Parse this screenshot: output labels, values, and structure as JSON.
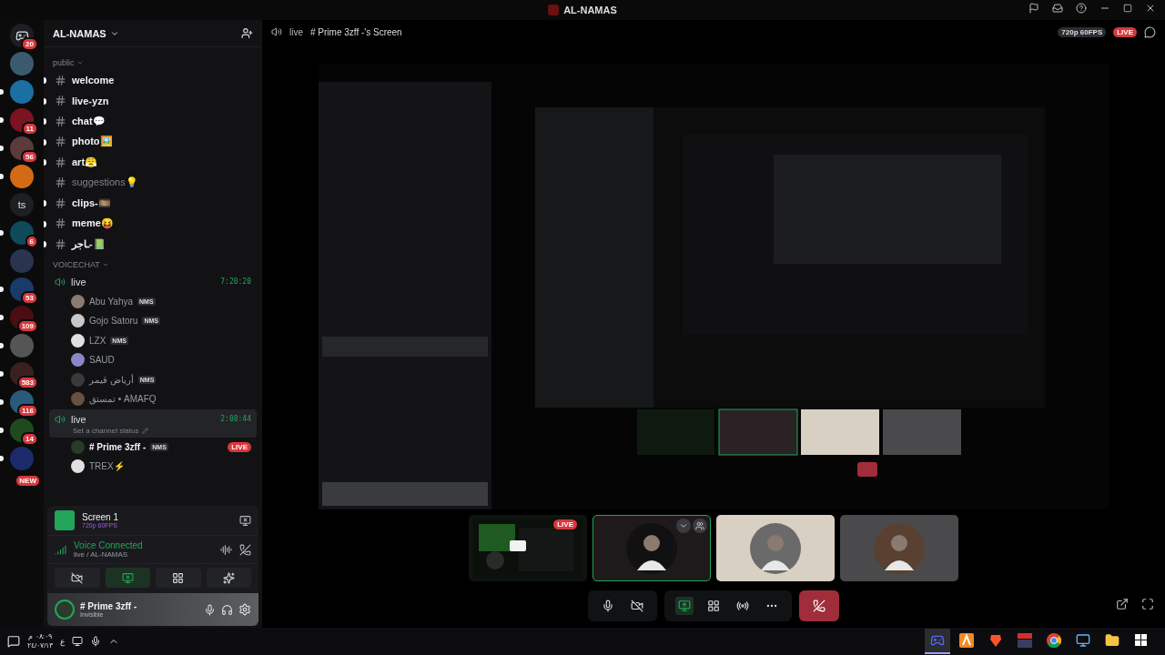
{
  "window": {
    "title": "AL-NAMAS"
  },
  "servers": [
    {
      "kind": "home",
      "badge": "20",
      "unread": false
    },
    {
      "kind": "avatar",
      "color": "#3b5a6e",
      "unread": false
    },
    {
      "kind": "avatar",
      "color": "#1c6fa3",
      "unread": true
    },
    {
      "kind": "avatar",
      "color": "#7a1420",
      "badge": "11",
      "unread": true
    },
    {
      "kind": "avatar",
      "color": "#5a3a3a",
      "badge": "56",
      "unread": true
    },
    {
      "kind": "avatar",
      "color": "#d46a14",
      "unread": true
    },
    {
      "kind": "text",
      "label": "ts",
      "unread": false
    },
    {
      "kind": "avatar",
      "color": "#0f4a5a",
      "badge": "6",
      "unread": true
    },
    {
      "kind": "avatar",
      "color": "#2a3350",
      "unread": false
    },
    {
      "kind": "avatar",
      "color": "#1a3a6a",
      "badge": "53",
      "unread": true
    },
    {
      "kind": "avatar",
      "color": "#4a0e12",
      "badge": "109",
      "unread": true
    },
    {
      "kind": "avatar",
      "color": "#555555",
      "unread": true
    },
    {
      "kind": "avatar",
      "color": "#3a2020",
      "badge": "583",
      "unread": true
    },
    {
      "kind": "avatar",
      "color": "#2a5a7a",
      "badge": "116",
      "unread": true
    },
    {
      "kind": "avatar",
      "color": "#1e4a1e",
      "badge": "14",
      "unread": true
    },
    {
      "kind": "avatar",
      "color": "#1a2a6a",
      "badge": "NEW",
      "unread": true
    }
  ],
  "server": {
    "name": "AL-NAMAS"
  },
  "categories": [
    {
      "name": "public",
      "channels": [
        {
          "kind": "text",
          "name": "welcome",
          "unread": true
        },
        {
          "kind": "text",
          "name": "live-yzn",
          "unread": true
        },
        {
          "kind": "text",
          "name": "chat💬",
          "unread": true
        },
        {
          "kind": "text",
          "name": "photo🖼️",
          "unread": true
        },
        {
          "kind": "text",
          "name": "art😤",
          "unread": true
        },
        {
          "kind": "text",
          "name": "suggestions💡",
          "unread": false
        },
        {
          "kind": "text",
          "name": "clips-🎞️",
          "unread": true
        },
        {
          "kind": "text",
          "name": "meme😝",
          "unread": true
        },
        {
          "kind": "text",
          "name": "ـاجر-📗",
          "unread": true
        }
      ]
    },
    {
      "name": "VOICECHAT",
      "channels": [
        {
          "kind": "voice",
          "name": "live",
          "timer": "7:20:20",
          "selected": false,
          "members": [
            {
              "name": "Abu Yahya",
              "tag": "NMS",
              "color": "#8a7a70",
              "live": false
            },
            {
              "name": "Gojo Satoru",
              "tag": "NMS",
              "color": "#c8c8c8",
              "live": false
            },
            {
              "name": "LZX",
              "tag": "NMS",
              "color": "#e0e0e0",
              "live": false
            },
            {
              "name": "SAUD",
              "color": "#8a86c8",
              "live": false
            },
            {
              "name": "أرياض قيمر",
              "tag": "NMS",
              "color": "#3a3a3a",
              "live": false
            },
            {
              "name": "تمستق • AMAFQ",
              "color": "#6a5040",
              "live": false
            }
          ]
        },
        {
          "kind": "voice",
          "name": "live",
          "timer": "2:08:44",
          "selected": true,
          "status": "Set a channel status",
          "members": [
            {
              "name": "# Prime 3zff -",
              "tag": "NMS",
              "color": "#2a3a2a",
              "live": true,
              "badge": "LIVE"
            },
            {
              "name": "TREX⚡",
              "color": "#e0e0e0",
              "live": false
            }
          ]
        }
      ]
    }
  ],
  "stream_panel": {
    "title": "Screen 1",
    "quality": "720p 60FPS"
  },
  "voice": {
    "status": "Voice Connected",
    "location": "live / AL-NAMAS"
  },
  "voice_buttons": [
    {
      "kind": "camera",
      "active": false
    },
    {
      "kind": "screen",
      "active": true
    },
    {
      "kind": "activities",
      "active": false
    },
    {
      "kind": "soundboard",
      "active": false
    }
  ],
  "user": {
    "name": "# Prime 3zff -",
    "status": "Invisible"
  },
  "stream_header": {
    "channel": "live",
    "title": "# Prime 3zff -'s Screen",
    "quality": "720p 60FPS",
    "badge": "LIVE"
  },
  "tiles": [
    {
      "kind": "screen",
      "badge": "LIVE",
      "color": "#101410",
      "selected": false
    },
    {
      "kind": "avatar",
      "color": "#1e1a1c",
      "selected": true
    },
    {
      "kind": "avatar",
      "color": "#d9d0c4",
      "selected": false
    },
    {
      "kind": "avatar",
      "color": "#4a4a4c",
      "selected": false
    }
  ],
  "taskbar": {
    "time": "٠٨:٠٩ م",
    "date": "٢٤/٠٧/١٣",
    "language": "ع",
    "apps": [
      {
        "kind": "discord",
        "active": true
      },
      {
        "kind": "orange",
        "active": false
      },
      {
        "kind": "brave",
        "active": false
      },
      {
        "kind": "red",
        "active": false
      },
      {
        "kind": "chrome",
        "active": false
      },
      {
        "kind": "computer",
        "active": false
      },
      {
        "kind": "folder",
        "active": false
      },
      {
        "kind": "windows",
        "active": false
      }
    ]
  }
}
